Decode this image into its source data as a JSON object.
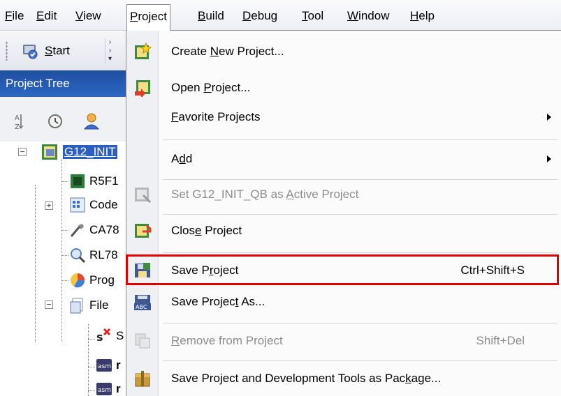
{
  "menubar": {
    "items": [
      {
        "label": "File",
        "u": "F",
        "rest": "ile"
      },
      {
        "label": "Edit",
        "u": "E",
        "rest": "dit"
      },
      {
        "label": "View",
        "u": "V",
        "rest": "iew"
      },
      {
        "label": "Project",
        "u": "P",
        "rest": "roject"
      },
      {
        "label": "Build",
        "u": "B",
        "rest": "uild"
      },
      {
        "label": "Debug",
        "u": "D",
        "rest": "ebug"
      },
      {
        "label": "Tool",
        "u": "T",
        "rest": "ool"
      },
      {
        "label": "Window",
        "u": "W",
        "rest": "indow"
      },
      {
        "label": "Help",
        "u": "H",
        "rest": "elp"
      }
    ],
    "open_menu": "Project"
  },
  "toolbar": {
    "start_label": "Start",
    "start_u": "S",
    "start_rest": "tart",
    "start_icon": "start-panel-icon"
  },
  "panel": {
    "title": "Project Tree",
    "tools": [
      "sort-icon",
      "clock-icon",
      "user-icon"
    ]
  },
  "tree": {
    "root": "G12_INIT",
    "nodes": [
      {
        "label": "R5F1",
        "icon": "microcontroller-icon"
      },
      {
        "label": "Code",
        "icon": "code-generator-icon"
      },
      {
        "label": "CA78",
        "icon": "compiler-icon"
      },
      {
        "label": "RL78",
        "icon": "debug-tool-icon"
      },
      {
        "label": "Prog",
        "icon": "program-analyzer-icon"
      },
      {
        "label": "File",
        "icon": "folder-icon"
      }
    ],
    "file_children": [
      {
        "label": "S",
        "icon": "source-file-icon"
      },
      {
        "label": "r",
        "icon": "asm-file-icon"
      },
      {
        "label": "r",
        "icon": "asm-file-icon"
      }
    ]
  },
  "dropdown": {
    "items": [
      {
        "pre": "Create ",
        "u": "N",
        "post": "ew Project...",
        "shortcut": "",
        "submenu": false,
        "disabled": false,
        "icon": "create-project-icon"
      },
      {
        "pre": "Open ",
        "u": "P",
        "post": "roject...",
        "shortcut": "",
        "submenu": false,
        "disabled": false,
        "icon": "open-project-icon"
      },
      {
        "pre": "",
        "u": "F",
        "post": "avorite Projects",
        "shortcut": "",
        "submenu": true,
        "disabled": false,
        "icon": ""
      },
      {
        "pre": "A",
        "u": "d",
        "post": "d",
        "shortcut": "",
        "submenu": true,
        "disabled": false,
        "icon": ""
      },
      {
        "pre": "Set G12_INIT_QB as ",
        "u": "A",
        "post": "ctive Project",
        "shortcut": "",
        "submenu": false,
        "disabled": true,
        "icon": "active-project-icon"
      },
      {
        "pre": "Clos",
        "u": "e",
        "post": " Project",
        "shortcut": "",
        "submenu": false,
        "disabled": false,
        "icon": "close-project-icon"
      },
      {
        "pre": "Save P",
        "u": "r",
        "post": "oject",
        "shortcut": "Ctrl+Shift+S",
        "submenu": false,
        "disabled": false,
        "icon": "save-project-icon"
      },
      {
        "pre": "Save Projec",
        "u": "t",
        "post": " As...",
        "shortcut": "",
        "submenu": false,
        "disabled": false,
        "icon": "save-project-as-icon"
      },
      {
        "pre": "",
        "u": "R",
        "post": "emove from Project",
        "shortcut": "Shift+Del",
        "submenu": false,
        "disabled": true,
        "icon": "remove-from-project-icon"
      },
      {
        "pre": "Save Project and Development Tools as Pac",
        "u": "k",
        "post": "age...",
        "shortcut": "",
        "submenu": false,
        "disabled": false,
        "icon": "package-icon"
      }
    ],
    "highlighted_item": "Save Project"
  },
  "colors": {
    "highlight_box": "#e00000",
    "panel_header": "#2c68c4",
    "selection": "#2b5fbf"
  }
}
